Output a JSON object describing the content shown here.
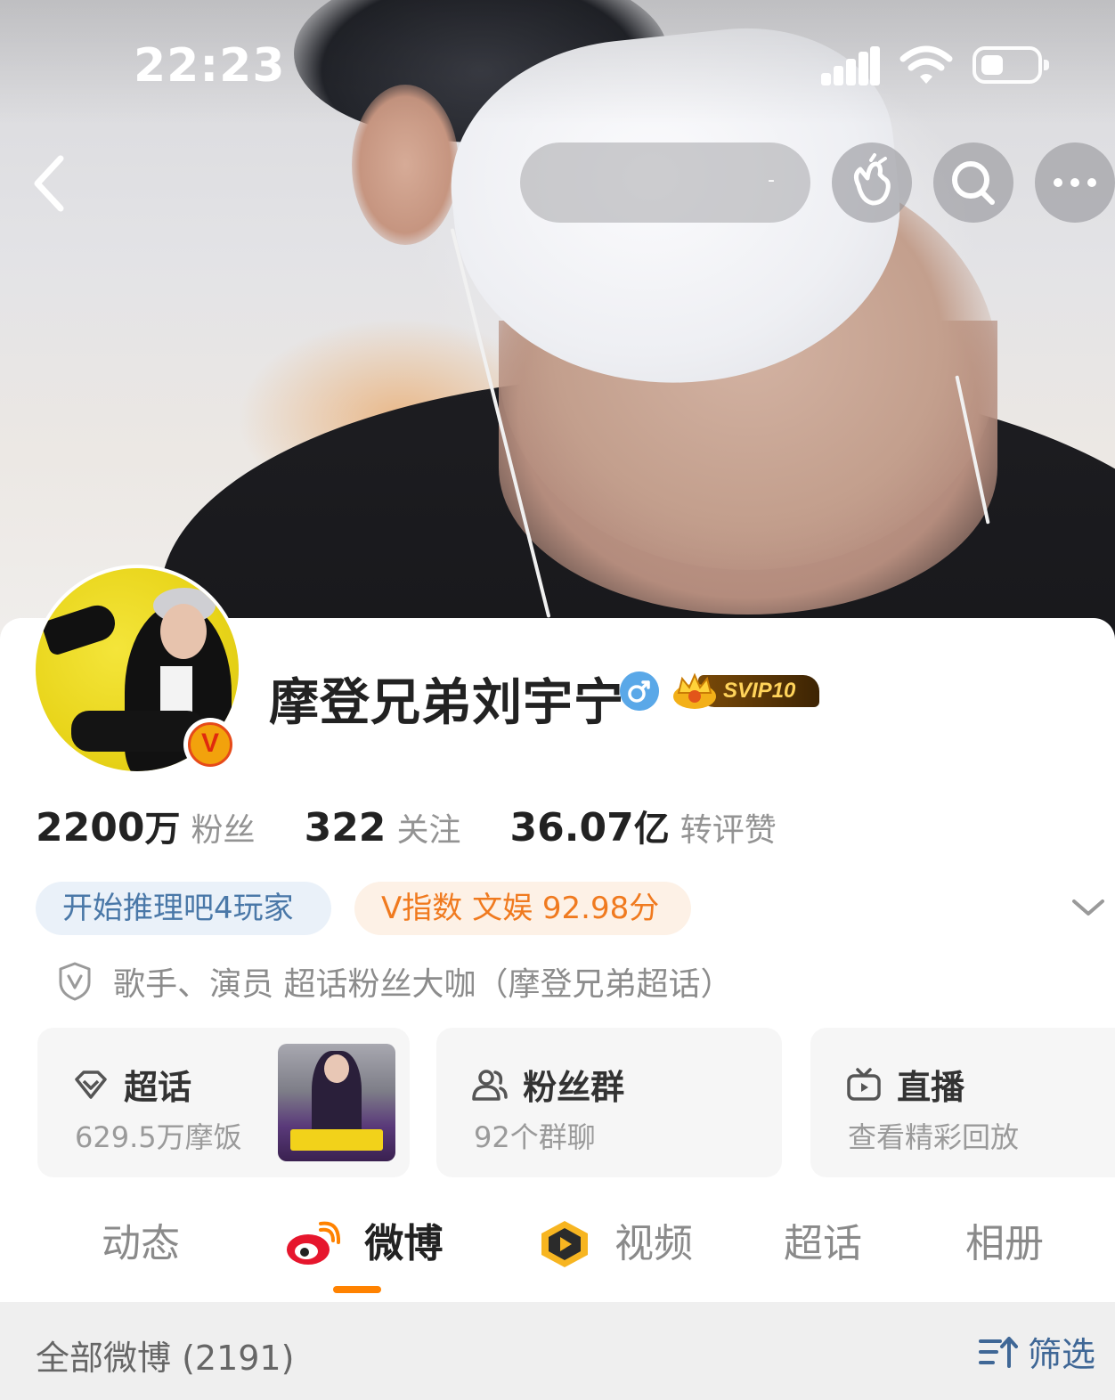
{
  "status_bar": {
    "time": "22:23"
  },
  "nav": {
    "back_icon": "chevron-left-icon",
    "search_hint": "-",
    "buttons": [
      "hand-wave-icon",
      "search-icon",
      "more-icon"
    ]
  },
  "profile": {
    "name": "摩登兄弟刘宇宁",
    "gender_symbol": "♂",
    "svip_label": "SVIP10",
    "verified_badge": "V",
    "stats": [
      {
        "value": "2200",
        "unit": "万",
        "label": "粉丝"
      },
      {
        "value": "322",
        "unit": "",
        "label": "关注"
      },
      {
        "value": "36.07",
        "unit": "亿",
        "label": "转评赞"
      }
    ],
    "tags": {
      "game": "开始推理吧4玩家",
      "v_index": "V指数 文娱 92.98分"
    },
    "verification": "歌手、演员 超话粉丝大咖（摩登兄弟超话）"
  },
  "tiles": [
    {
      "title": "超话",
      "subtitle": "629.5万摩饭",
      "icon": "diamond-icon"
    },
    {
      "title": "粉丝群",
      "subtitle": "92个群聊",
      "icon": "people-icon"
    },
    {
      "title": "直播",
      "subtitle": "查看精彩回放",
      "icon": "tv-icon"
    }
  ],
  "tabs": [
    "动态",
    "微博",
    "视频",
    "超话",
    "相册"
  ],
  "active_tab": "微博",
  "feed_bar": {
    "all_posts": "全部微博 (2191)",
    "filter": "筛选"
  },
  "colors": {
    "accent": "#ff8200",
    "link_blue": "#3f6796",
    "v_orange": "#f07a1f"
  }
}
